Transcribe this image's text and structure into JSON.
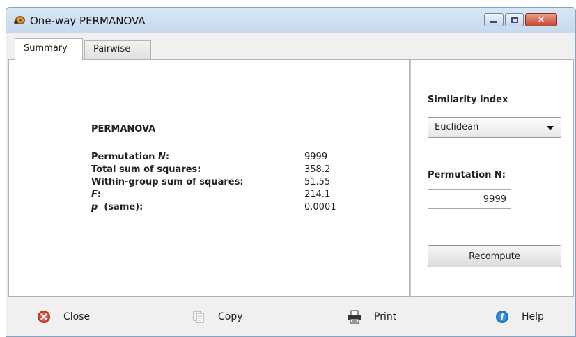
{
  "window": {
    "title": "One-way PERMANOVA"
  },
  "tabs": [
    {
      "label": "Summary",
      "active": true
    },
    {
      "label": "Pairwise",
      "active": false
    }
  ],
  "summary": {
    "heading": "PERMANOVA",
    "rows": [
      {
        "label": "Permutation ",
        "label_italic": "N",
        "label_suffix": ":",
        "value": "9999"
      },
      {
        "label": "Total sum of squares:",
        "value": "358.2"
      },
      {
        "label": "Within-group sum of squares:",
        "value": "51.55"
      },
      {
        "label": "",
        "label_italic": "F",
        "label_suffix": ":",
        "value": "214.1"
      },
      {
        "label": "",
        "label_italic": "p",
        "label_suffix": "  (same):",
        "value": "0.0001"
      }
    ]
  },
  "side": {
    "similarity_label": "Similarity index",
    "similarity_value": "Euclidean",
    "permutation_label": "Permutation N:",
    "permutation_value": "9999",
    "recompute_label": "Recompute"
  },
  "toolbar": {
    "close_label": "Close",
    "copy_label": "Copy",
    "print_label": "Print",
    "help_label": "Help"
  },
  "colors": {
    "close_icon": "#c0392b",
    "help_icon": "#1e73c8",
    "title_bar": "#c6d9ee"
  }
}
